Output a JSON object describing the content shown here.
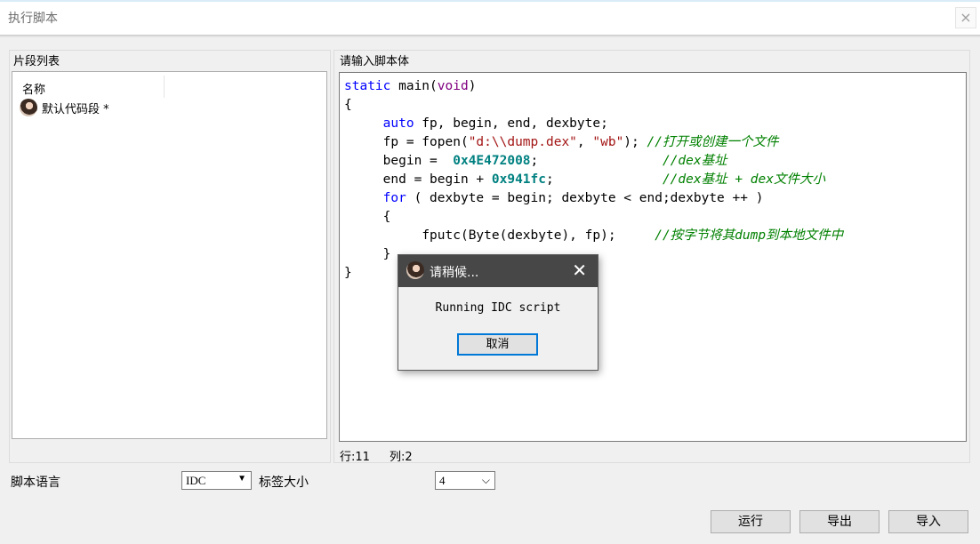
{
  "window": {
    "title": "执行脚本",
    "close": "×"
  },
  "left": {
    "group_label": "片段列表",
    "column_header": "名称",
    "items": [
      {
        "label": "默认代码段 *"
      }
    ]
  },
  "right": {
    "group_label": "请输入脚本体",
    "code": {
      "l1_static": "static",
      "l1_main": " main(",
      "l1_void": "void",
      "l1_end": ")",
      "l2": "{",
      "l3_auto": "auto",
      "l3_rest": " fp, begin, end, dexbyte;",
      "l4_a": "fp = fopen(",
      "l4_s1": "\"d:\\\\dump.dex\"",
      "l4_b": ", ",
      "l4_s2": "\"wb\"",
      "l4_c": "); ",
      "l4_cmt": "//打开或创建一个文件",
      "l5_a": "begin =  ",
      "l5_num": "0x4E472008",
      "l5_b": ";",
      "l5_cmt": "//dex基址",
      "l6_a": "end = begin + ",
      "l6_num": "0x941fc",
      "l6_b": ";",
      "l6_cmt": "//dex基址 + dex文件大小",
      "l7_for": "for",
      "l7_rest": " ( dexbyte = begin; dexbyte < end;dexbyte ++ )",
      "l8": "{",
      "l9_a": "fputc(Byte(dexbyte), fp);",
      "l9_cmt": "//按字节将其dump到本地文件中",
      "l10": "}",
      "l11": "}"
    },
    "status_line": "行:11",
    "status_col": "列:2"
  },
  "bottom": {
    "lang_label": "脚本语言",
    "lang_value": "IDC",
    "tab_label": "标签大小",
    "tab_value": "4",
    "run": "运行",
    "export": "导出",
    "import": "导入"
  },
  "dialog": {
    "title": "请稍候...",
    "close": "✕",
    "message": "Running IDC script",
    "cancel": "取消"
  }
}
